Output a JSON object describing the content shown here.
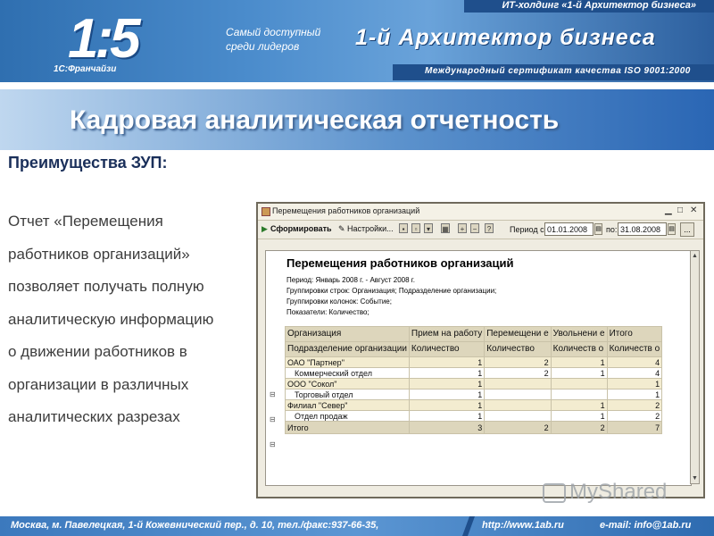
{
  "banner": {
    "holding": "ИТ-холдинг «1-й Архитектор бизнеса»",
    "logo_text": "1С:Франчайзи",
    "tagline": "Самый доступный среди лидеров",
    "title": "1-й Архитектор бизнеса",
    "certificate": "Международный сертификат качества ISO 9001:2000"
  },
  "heading": "Кадровая аналитическая отчетность",
  "subheading": "Преимущества ЗУП:",
  "body_lines": [
    "Отчет «Перемещения",
    "работников организаций»",
    "позволяет получать полную",
    "аналитическую информацию",
    "о движении работников в",
    "организации в различных",
    "аналитических разрезах"
  ],
  "window": {
    "title": "Перемещения работников организаций",
    "toolbar": {
      "generate_label": "Сформировать",
      "settings_label": "Настройки...",
      "period_from_label": "Период с:",
      "period_from": "01.01.2008",
      "period_to_label": "по:",
      "period_to": "31.08.2008",
      "more_label": "..."
    },
    "report": {
      "title": "Перемещения работников организаций",
      "meta": [
        "Период: Январь 2008 г. - Август 2008 г.",
        "Группировки строк: Организация; Подразделение организации;",
        "Группировки колонок: Событие;",
        "Показатели: Количество;"
      ],
      "header_row1": [
        "Организация",
        "Прием на работу",
        "Перемещени е",
        "Увольнени е",
        "Итого"
      ],
      "header_row2": [
        "Подразделение организации",
        "Количество",
        "Количество",
        "Количеств о",
        "Количеств о"
      ],
      "rows": [
        {
          "name": "ОАО \"Партнер\"",
          "level": 1,
          "hire": "1",
          "move": "2",
          "fire": "1",
          "total": "4"
        },
        {
          "name": "Коммерческий отдел",
          "level": 2,
          "hire": "1",
          "move": "2",
          "fire": "1",
          "total": "4"
        },
        {
          "name": "ООО \"Сокол\"",
          "level": 1,
          "hire": "1",
          "move": "",
          "fire": "",
          "total": "1"
        },
        {
          "name": "Торговый отдел",
          "level": 2,
          "hire": "1",
          "move": "",
          "fire": "",
          "total": "1"
        },
        {
          "name": "Филиал \"Север\"",
          "level": 1,
          "hire": "1",
          "move": "",
          "fire": "1",
          "total": "2"
        },
        {
          "name": "Отдел продаж",
          "level": 2,
          "hire": "1",
          "move": "",
          "fire": "1",
          "total": "2"
        }
      ],
      "total": {
        "name": "Итого",
        "hire": "3",
        "move": "2",
        "fire": "2",
        "total": "7"
      }
    }
  },
  "footer": {
    "address": "Москва, м. Павелецкая, 1-й Кожевнический пер., д. 10, тел./факс:937-66-35,",
    "site": "http://www.1ab.ru",
    "email": "e-mail: info@1ab.ru"
  },
  "watermark": "MyShared"
}
